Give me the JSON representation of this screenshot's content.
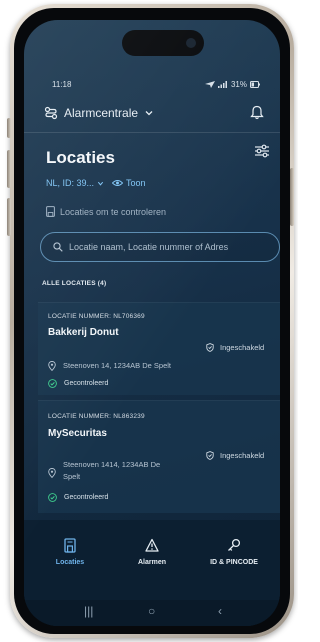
{
  "status_bar": {
    "time": "11:18",
    "battery": "31%"
  },
  "header": {
    "central_label": "Alarmcentrale"
  },
  "page": {
    "title": "Locaties",
    "filter_summary": "NL, ID: 39...",
    "toggle_label": "Toon",
    "check_link": "Locaties om te controleren"
  },
  "search": {
    "placeholder": "Locatie naam, Locatie nummer of Adres"
  },
  "list": {
    "section_label": "ALLE LOCATIES (4)",
    "items": [
      {
        "number": "LOCATIE NUMMER: NL706369",
        "name": "Bakkerij Donut",
        "address": "Steenoven 14, 1234AB De Spelt",
        "state": "Ingeschakeld",
        "check": "Gecontroleerd"
      },
      {
        "number": "LOCATIE NUMMER: NL863239",
        "name": "MySecuritas",
        "address": "Steenoven 1414, 1234AB De Spelt",
        "state": "Ingeschakeld",
        "check": "Gecontroleerd"
      }
    ]
  },
  "tabs": [
    {
      "label": "Locaties",
      "icon": "building-icon",
      "active": true
    },
    {
      "label": "Alarmen",
      "icon": "warning-triangle-icon",
      "active": false
    },
    {
      "label": "ID & PINCODE",
      "icon": "key-icon",
      "active": false
    }
  ],
  "system_nav": {
    "recents": "|||",
    "home": "○",
    "back": "‹"
  },
  "colors": {
    "background": "#17314a",
    "accent": "#6fb3ea",
    "link": "#7fc4f4",
    "card": "#18364e",
    "tabbar": "#0c1f31",
    "ok_green": "#3ecf8e"
  }
}
